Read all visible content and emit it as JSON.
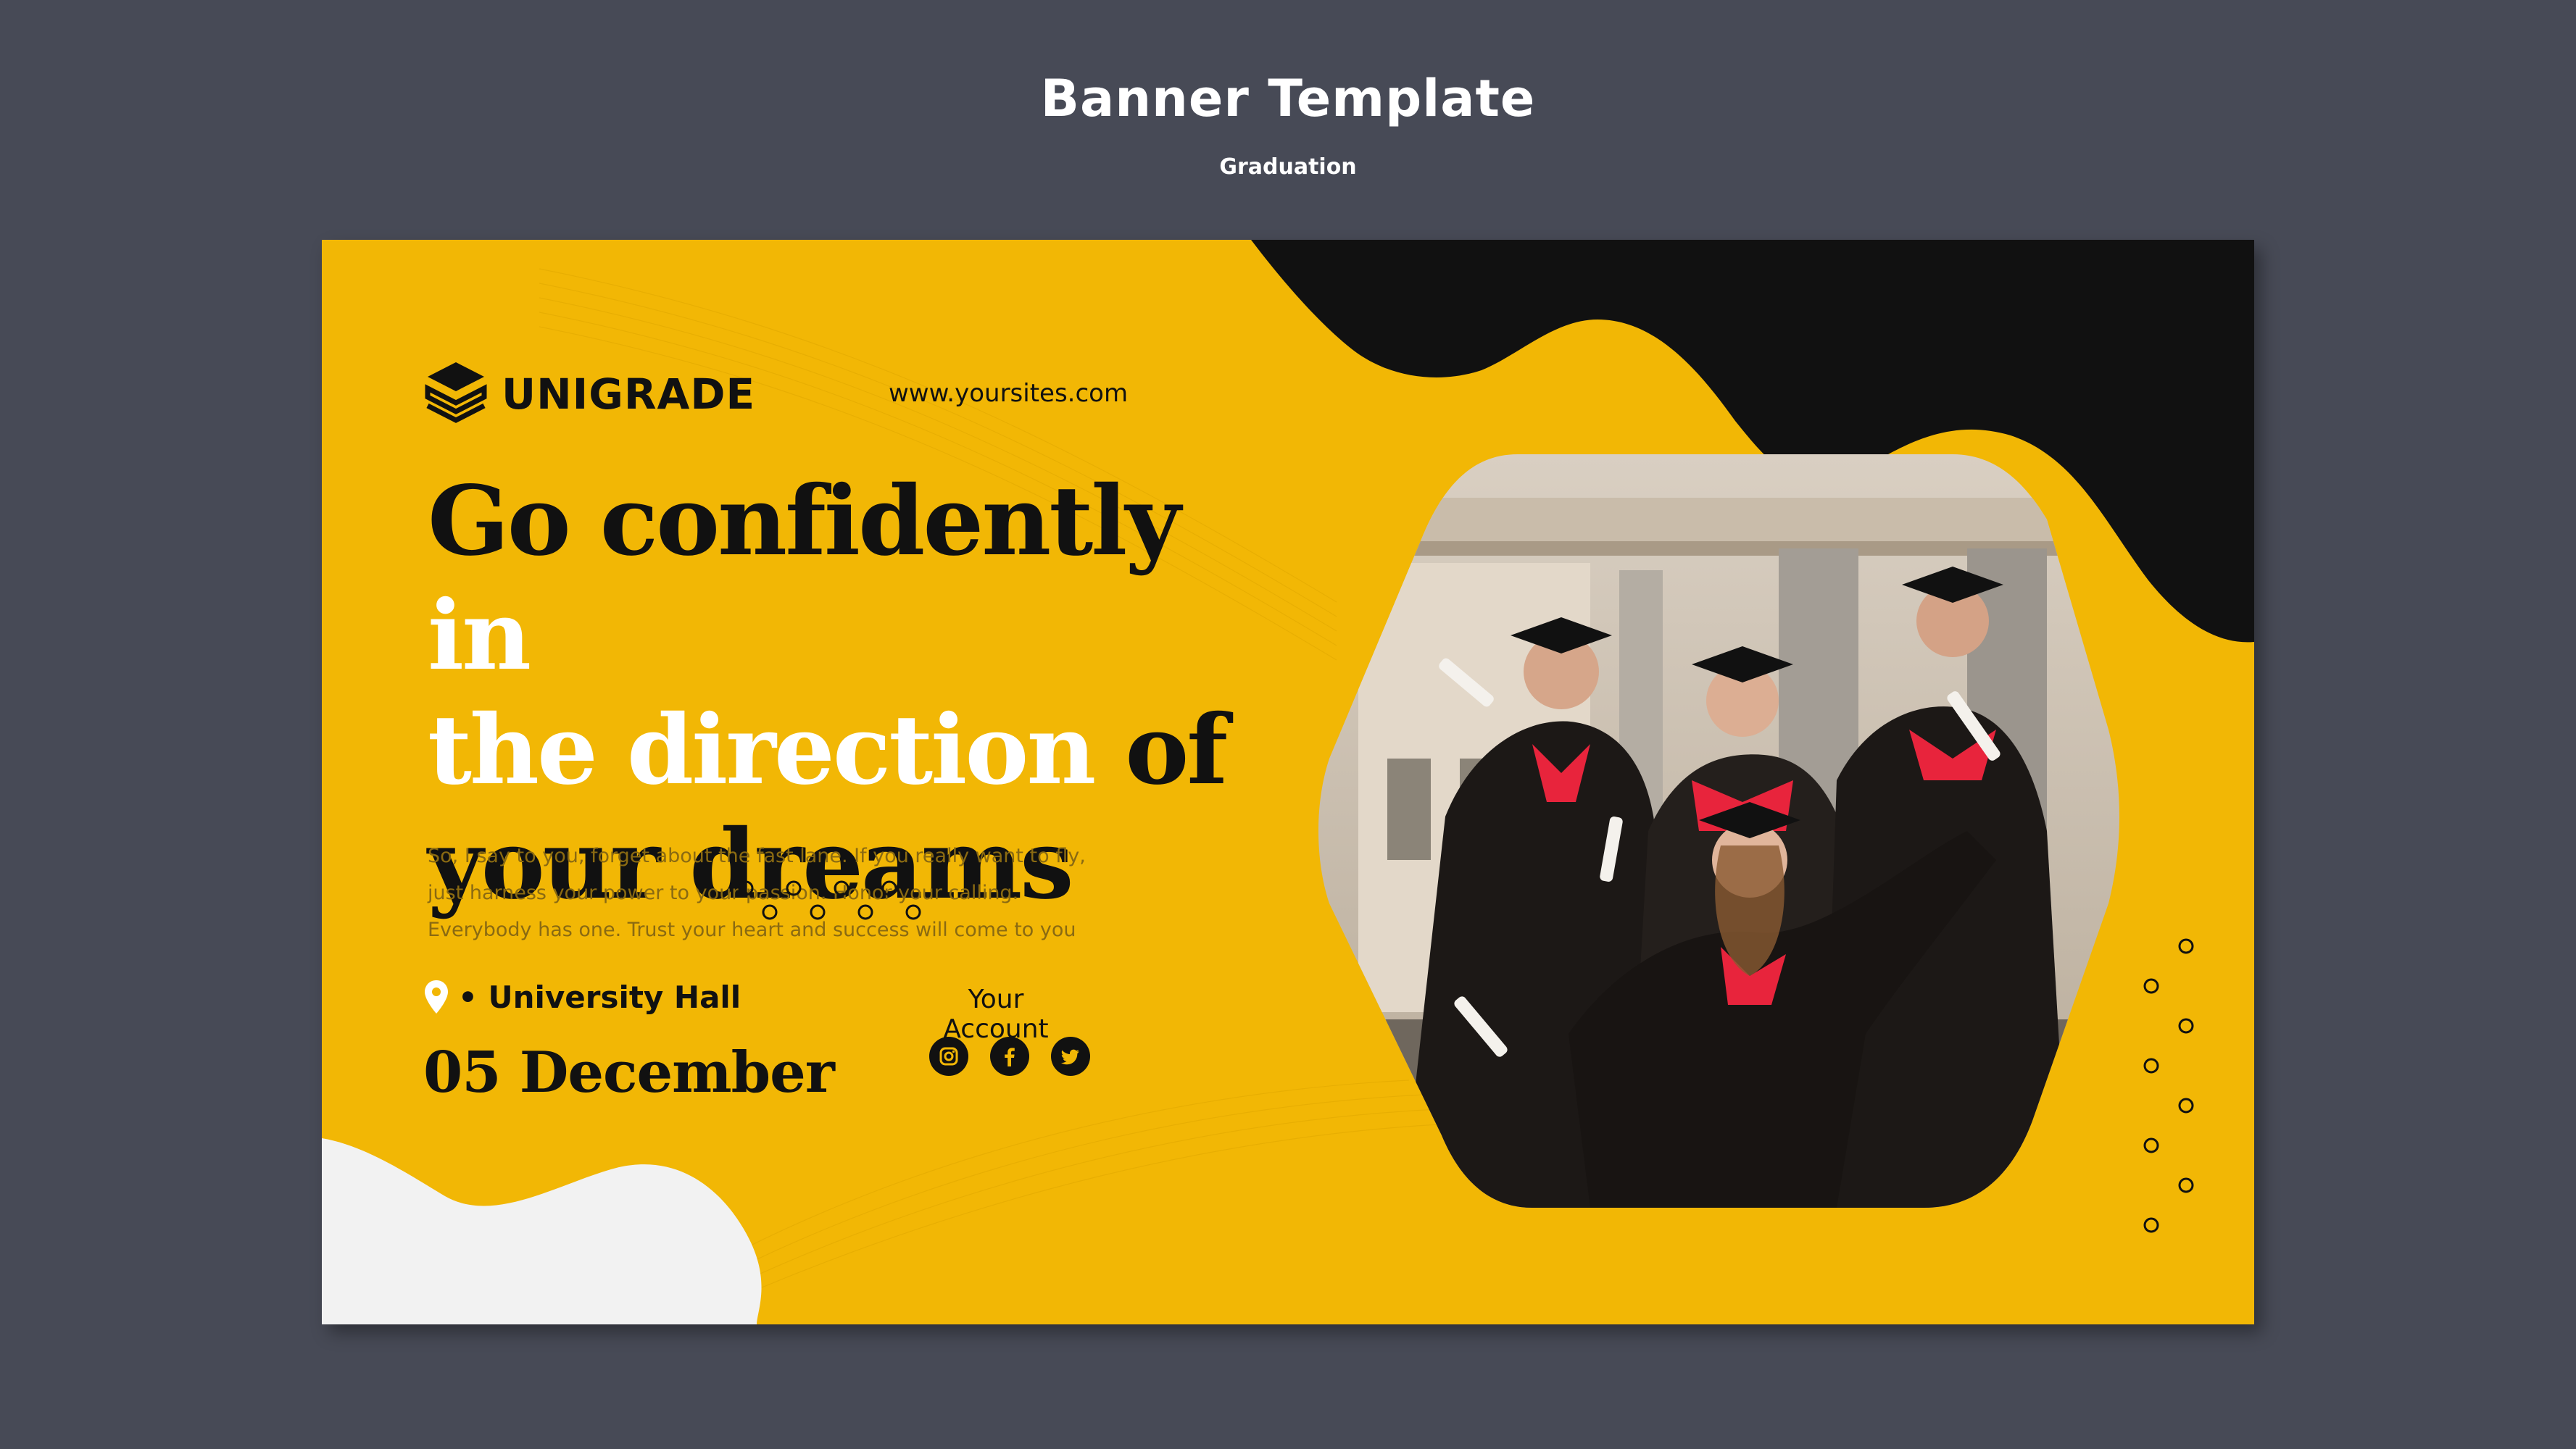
{
  "header": {
    "title": "Banner Template",
    "subtitle": "Graduation"
  },
  "banner": {
    "brand": "UNIGRADE",
    "website": "www.yoursites.com",
    "headline": {
      "line1_dark": "Go confidently ",
      "line1_light": "in",
      "line2_light": "the direction ",
      "line2_dark": "of",
      "line3_dark": "your dreams"
    },
    "body_lines": [
      "So, I say to you, forget about the fast lane. If you really want to fly,",
      "just harness your power to your passion. Honor your calling.",
      "Everybody has one. Trust your heart and success will come to you"
    ],
    "location": "• University Hall",
    "date": "05 December",
    "account_label": "Your Account",
    "social": [
      "instagram-icon",
      "facebook-icon",
      "twitter-icon"
    ]
  },
  "colors": {
    "page_background": "#474a56",
    "banner_yellow": "#f2b705",
    "dark": "#111111",
    "light_blob": "#f2f2f2",
    "gown_trim": "#e8243c"
  }
}
